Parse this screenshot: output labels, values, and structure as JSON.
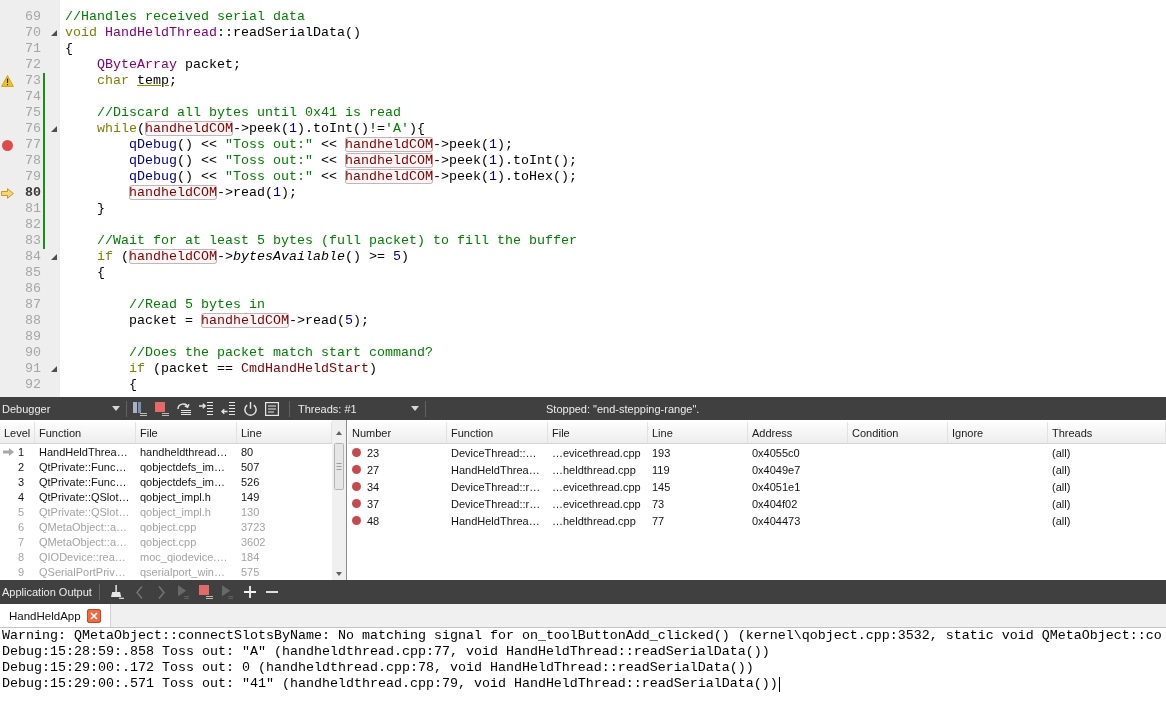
{
  "editor": {
    "lines": [
      {
        "number": "69",
        "warning": false,
        "breakpoint": false,
        "current": false,
        "foldable": false,
        "changed": false,
        "tokens": [
          {
            "kind": "comment",
            "text": "//Handles received serial data"
          }
        ]
      },
      {
        "number": "70",
        "warning": false,
        "breakpoint": false,
        "current": false,
        "foldable": true,
        "changed": false,
        "tokens": [
          {
            "kind": "keyword",
            "text": "void"
          },
          {
            "kind": "type",
            "text": " HandHeldThread"
          },
          {
            "kind": "plain",
            "text": "::readSerialData()"
          }
        ]
      },
      {
        "number": "71",
        "warning": false,
        "breakpoint": false,
        "current": false,
        "foldable": false,
        "changed": false,
        "tokens": [
          {
            "kind": "plain",
            "text": "{"
          }
        ]
      },
      {
        "number": "72",
        "warning": false,
        "breakpoint": false,
        "current": false,
        "foldable": false,
        "changed": false,
        "tokens": [
          {
            "kind": "type",
            "text": "    QByteArray"
          },
          {
            "kind": "plain",
            "text": " packet;"
          }
        ]
      },
      {
        "number": "73",
        "warning": true,
        "breakpoint": false,
        "current": false,
        "foldable": false,
        "changed": true,
        "tokens": [
          {
            "kind": "keyword",
            "text": "    char "
          },
          {
            "kind": "unused",
            "text": "temp"
          },
          {
            "kind": "plain",
            "text": ";"
          }
        ]
      },
      {
        "number": "74",
        "warning": false,
        "breakpoint": false,
        "current": false,
        "foldable": false,
        "changed": true
      },
      {
        "number": "75",
        "warning": false,
        "breakpoint": false,
        "current": false,
        "foldable": false,
        "changed": true,
        "tokens": [
          {
            "kind": "comment",
            "text": "    //Discard all bytes until 0x41 is read"
          }
        ]
      },
      {
        "number": "76",
        "warning": false,
        "breakpoint": false,
        "current": false,
        "foldable": true,
        "changed": true,
        "tokens": [
          {
            "kind": "keyword",
            "text": "    while"
          },
          {
            "kind": "plain",
            "text": "("
          },
          {
            "kind": "occurrence",
            "text": "handheldCOM"
          },
          {
            "kind": "plain",
            "text": "->peek("
          },
          {
            "kind": "number",
            "text": "1"
          },
          {
            "kind": "plain",
            "text": ").toInt()!="
          },
          {
            "kind": "string",
            "text": "'A'"
          },
          {
            "kind": "plain",
            "text": "){"
          }
        ]
      },
      {
        "number": "77",
        "warning": false,
        "breakpoint": true,
        "current": false,
        "foldable": false,
        "changed": true,
        "tokens": [
          {
            "kind": "macro",
            "text": "        qDebug"
          },
          {
            "kind": "plain",
            "text": "() << "
          },
          {
            "kind": "string",
            "text": "\"Toss out:\""
          },
          {
            "kind": "plain",
            "text": " << "
          },
          {
            "kind": "occurrence",
            "text": "handheldCOM"
          },
          {
            "kind": "plain",
            "text": "->peek("
          },
          {
            "kind": "number",
            "text": "1"
          },
          {
            "kind": "plain",
            "text": ");"
          }
        ]
      },
      {
        "number": "78",
        "warning": false,
        "breakpoint": false,
        "current": false,
        "foldable": false,
        "changed": true,
        "tokens": [
          {
            "kind": "macro",
            "text": "        qDebug"
          },
          {
            "kind": "plain",
            "text": "() << "
          },
          {
            "kind": "string",
            "text": "\"Toss out:\""
          },
          {
            "kind": "plain",
            "text": " << "
          },
          {
            "kind": "occurrence",
            "text": "handheldCOM"
          },
          {
            "kind": "plain",
            "text": "->peek("
          },
          {
            "kind": "number",
            "text": "1"
          },
          {
            "kind": "plain",
            "text": ").toInt();"
          }
        ]
      },
      {
        "number": "79",
        "warning": false,
        "breakpoint": false,
        "current": false,
        "foldable": false,
        "changed": true,
        "tokens": [
          {
            "kind": "macro",
            "text": "        qDebug"
          },
          {
            "kind": "plain",
            "text": "() << "
          },
          {
            "kind": "string",
            "text": "\"Toss out:\""
          },
          {
            "kind": "plain",
            "text": " << "
          },
          {
            "kind": "occurrence",
            "text": "handheldCOM"
          },
          {
            "kind": "plain",
            "text": "->peek("
          },
          {
            "kind": "number",
            "text": "1"
          },
          {
            "kind": "plain",
            "text": ").toHex();"
          }
        ]
      },
      {
        "number": "80",
        "warning": false,
        "breakpoint": false,
        "current": true,
        "foldable": false,
        "changed": true,
        "tokens": [
          {
            "kind": "occurrence",
            "text": "        handheldCOM"
          },
          {
            "kind": "plain",
            "text": "->read("
          },
          {
            "kind": "number",
            "text": "1"
          },
          {
            "kind": "plain",
            "text": ");"
          }
        ]
      },
      {
        "number": "81",
        "warning": false,
        "breakpoint": false,
        "current": false,
        "foldable": false,
        "changed": true,
        "tokens": [
          {
            "kind": "plain",
            "text": "    }"
          }
        ]
      },
      {
        "number": "82",
        "warning": false,
        "breakpoint": false,
        "current": false,
        "foldable": false,
        "changed": true
      },
      {
        "number": "83",
        "warning": false,
        "breakpoint": false,
        "current": false,
        "foldable": false,
        "changed": true,
        "tokens": [
          {
            "kind": "comment",
            "text": "    //Wait for at least 5 bytes (full packet) to fill the buffer"
          }
        ]
      },
      {
        "number": "84",
        "warning": false,
        "breakpoint": false,
        "current": false,
        "foldable": true,
        "changed": false,
        "tokens": [
          {
            "kind": "keyword",
            "text": "    if"
          },
          {
            "kind": "plain",
            "text": " ("
          },
          {
            "kind": "occurrence",
            "text": "handheldCOM"
          },
          {
            "kind": "plain",
            "text": "->"
          },
          {
            "kind": "virtual",
            "text": "bytesAvailable"
          },
          {
            "kind": "plain",
            "text": "() >= "
          },
          {
            "kind": "number",
            "text": "5"
          },
          {
            "kind": "plain",
            "text": ")"
          }
        ]
      },
      {
        "number": "85",
        "warning": false,
        "breakpoint": false,
        "current": false,
        "foldable": false,
        "changed": false,
        "tokens": [
          {
            "kind": "plain",
            "text": "    {"
          }
        ]
      },
      {
        "number": "86",
        "warning": false,
        "breakpoint": false,
        "current": false,
        "foldable": false,
        "changed": false
      },
      {
        "number": "87",
        "warning": false,
        "breakpoint": false,
        "current": false,
        "foldable": false,
        "changed": false,
        "tokens": [
          {
            "kind": "comment",
            "text": "        //Read 5 bytes in"
          }
        ]
      },
      {
        "number": "88",
        "warning": false,
        "breakpoint": false,
        "current": false,
        "foldable": false,
        "changed": false,
        "tokens": [
          {
            "kind": "plain",
            "text": "        packet = "
          },
          {
            "kind": "occurrence",
            "text": "handheldCOM"
          },
          {
            "kind": "plain",
            "text": "->read("
          },
          {
            "kind": "number",
            "text": "5"
          },
          {
            "kind": "plain",
            "text": ");"
          }
        ]
      },
      {
        "number": "89",
        "warning": false,
        "breakpoint": false,
        "current": false,
        "foldable": false,
        "changed": false
      },
      {
        "number": "90",
        "warning": false,
        "breakpoint": false,
        "current": false,
        "foldable": false,
        "changed": false,
        "tokens": [
          {
            "kind": "comment",
            "text": "        //Does the packet match start command?"
          }
        ]
      },
      {
        "number": "91",
        "warning": false,
        "breakpoint": false,
        "current": false,
        "foldable": true,
        "changed": false,
        "tokens": [
          {
            "kind": "keyword",
            "text": "        if"
          },
          {
            "kind": "plain",
            "text": " (packet == "
          },
          {
            "kind": "global",
            "text": "CmdHandHeldStart"
          },
          {
            "kind": "plain",
            "text": ")"
          }
        ]
      },
      {
        "number": "92",
        "warning": false,
        "breakpoint": false,
        "current": false,
        "foldable": false,
        "changed": false,
        "tokens": [
          {
            "kind": "plain",
            "text": "        {"
          }
        ]
      }
    ]
  },
  "debugger_toolbar": {
    "perspective": "Debugger",
    "tools": [
      {
        "kind": "interrupt"
      },
      {
        "kind": "stop"
      },
      {
        "kind": "step_over"
      },
      {
        "kind": "step_into"
      },
      {
        "kind": "step_out"
      },
      {
        "kind": "restart"
      },
      {
        "kind": "instruction_mode"
      }
    ],
    "threads": "Threads: #1",
    "status": "Stopped: \"end-stepping-range\"."
  },
  "stack": {
    "columns": [
      "Level",
      "Function",
      "File",
      "Line"
    ],
    "frames": [
      {
        "level": "1",
        "function": "HandHeldThrea…",
        "file": "handheldthread…",
        "line": "80",
        "current": true,
        "disabled": false
      },
      {
        "level": "2",
        "function": "QtPrivate::Func…",
        "file": "qobjectdefs_im…",
        "line": "507",
        "current": false,
        "disabled": false
      },
      {
        "level": "3",
        "function": "QtPrivate::Func…",
        "file": "qobjectdefs_im…",
        "line": "526",
        "current": false,
        "disabled": false
      },
      {
        "level": "4",
        "function": "QtPrivate::QSlot…",
        "file": "qobject_impl.h",
        "line": "149",
        "current": false,
        "disabled": false
      },
      {
        "level": "5",
        "function": "QtPrivate::QSlot…",
        "file": "qobject_impl.h",
        "line": "130",
        "current": false,
        "disabled": true
      },
      {
        "level": "6",
        "function": "QMetaObject::a…",
        "file": "qobject.cpp",
        "line": "3723",
        "current": false,
        "disabled": true
      },
      {
        "level": "7",
        "function": "QMetaObject::a…",
        "file": "qobject.cpp",
        "line": "3602",
        "current": false,
        "disabled": true
      },
      {
        "level": "8",
        "function": "QIODevice::rea…",
        "file": "moc_qiodevice.…",
        "line": "184",
        "current": false,
        "disabled": true
      },
      {
        "level": "9",
        "function": "QSerialPortPriv…",
        "file": "qserialport_win…",
        "line": "575",
        "current": false,
        "disabled": true
      }
    ]
  },
  "breakpoints": {
    "columns": [
      "Number",
      "Function",
      "File",
      "Line",
      "Address",
      "Condition",
      "Ignore",
      "Threads"
    ],
    "rows": [
      {
        "number": "23",
        "function": "DeviceThread::…",
        "file": "…evicethread.cpp",
        "line": "193",
        "address": "0x4055c0",
        "threads": "(all)"
      },
      {
        "number": "27",
        "function": "HandHeldThrea…",
        "file": "…heldthread.cpp",
        "line": "119",
        "address": "0x4049e7",
        "threads": "(all)"
      },
      {
        "number": "34",
        "function": "DeviceThread::r…",
        "file": "…evicethread.cpp",
        "line": "145",
        "address": "0x4051e1",
        "threads": "(all)"
      },
      {
        "number": "37",
        "function": "DeviceThread::r…",
        "file": "…evicethread.cpp",
        "line": "73",
        "address": "0x404f02",
        "threads": "(all)"
      },
      {
        "number": "48",
        "function": "HandHeldThrea…",
        "file": "…heldthread.cpp",
        "line": "77",
        "address": "0x404473",
        "threads": "(all)"
      }
    ]
  },
  "output_toolbar": {
    "title": "Application Output",
    "tools": [
      {
        "kind": "clear",
        "disabled": false
      },
      {
        "kind": "previous",
        "disabled": true
      },
      {
        "kind": "next",
        "disabled": true
      },
      {
        "kind": "rerun",
        "disabled": true
      },
      {
        "kind": "stop",
        "disabled": false
      },
      {
        "kind": "attach",
        "disabled": true
      },
      {
        "kind": "zoom_in",
        "disabled": false
      },
      {
        "kind": "zoom_out",
        "disabled": false
      }
    ]
  },
  "output_tabs": [
    {
      "label": "HandHeldApp",
      "selected": true
    }
  ],
  "output_lines": [
    "Warning: QMetaObject::connectSlotsByName: No matching signal for on_toolButtonAdd_clicked() (kernel\\qobject.cpp:3532, static void QMetaObject::co",
    "Debug:15:28:59:.858 Toss out: \"A\" (handheldthread.cpp:77, void HandHeldThread::readSerialData())",
    "Debug:15:29:00:.172 Toss out: 0 (handheldthread.cpp:78, void HandHeldThread::readSerialData())",
    "Debug:15:29:00:.571 Toss out: \"41\" (handheldthread.cpp:79, void HandHeldThread::readSerialData())"
  ]
}
